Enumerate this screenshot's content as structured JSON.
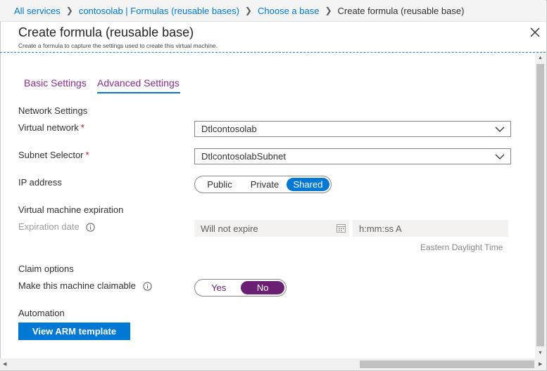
{
  "breadcrumb": {
    "items": [
      "All services",
      "contosolab | Formulas (reusable bases)",
      "Choose a base"
    ],
    "current": "Create formula (reusable base)"
  },
  "header": {
    "title": "Create formula (reusable base)",
    "subtitle": "Create a formula to capture the settings used to create this virtual machine."
  },
  "tabs": [
    {
      "label": "Basic Settings",
      "active": false
    },
    {
      "label": "Advanced Settings",
      "active": true
    }
  ],
  "network": {
    "section": "Network Settings",
    "vnet_label": "Virtual network",
    "vnet_value": "Dtlcontosolab",
    "subnet_label": "Subnet Selector",
    "subnet_value": "DtlcontosolabSubnet",
    "required_mark": "*",
    "ip_label": "IP address",
    "ip_options": [
      "Public",
      "Private",
      "Shared"
    ],
    "ip_selected": "Shared"
  },
  "expiration": {
    "section": "Virtual machine expiration",
    "date_label": "Expiration date",
    "date_placeholder": "Will not expire",
    "time_placeholder": "h:mm:ss A",
    "timezone": "Eastern Daylight Time"
  },
  "claim": {
    "section": "Claim options",
    "label": "Make this machine claimable",
    "options": [
      "Yes",
      "No"
    ],
    "selected": "No"
  },
  "automation": {
    "section": "Automation",
    "button": "View ARM template"
  },
  "colors": {
    "link_blue": "#0078d4",
    "tab_purple": "#8a2d8f",
    "toggle_purple": "#6b1f73",
    "required_red": "#c50f1f"
  },
  "icons": [
    "chevron-right-icon",
    "close-icon",
    "chevron-down-icon",
    "info-icon",
    "calendar-icon",
    "scroll-arrow-icon"
  ]
}
